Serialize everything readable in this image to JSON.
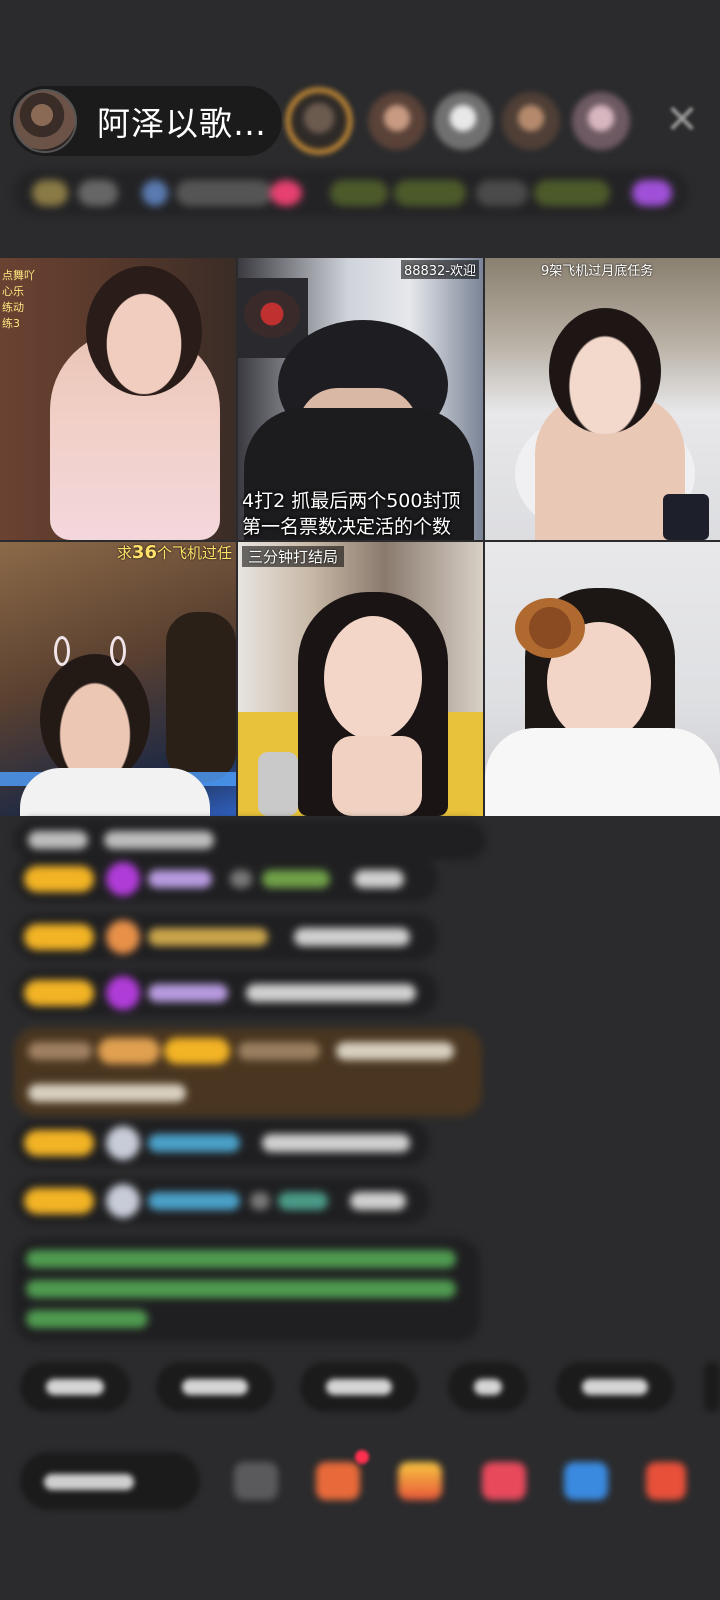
{
  "header": {
    "host_name": "阿泽以歌…",
    "close_icon": "close-icon"
  },
  "video_grid": {
    "tiles": [
      {
        "side_lines": [
          "点舞吖",
          "心乐",
          "练动",
          "练3"
        ]
      },
      {
        "top_caption": "88832-欢迎",
        "caption_line1": "4打2  抓最后两个500封顶",
        "caption_line2": "第一名票数决定活的个数"
      },
      {
        "top_caption": "9架飞机过月底任务"
      },
      {
        "top_caption_prefix": "求",
        "top_caption_number": "36",
        "top_caption_suffix": "个飞机过任"
      },
      {
        "top_caption": "三分钟打结局"
      },
      {}
    ]
  },
  "colors": {
    "background": "#2b2b2d",
    "header_pill": "#1b1b1c",
    "rank_ring": "#f0a63a",
    "badge": "#f2b324",
    "caption_yellow": "#ffe16a"
  }
}
